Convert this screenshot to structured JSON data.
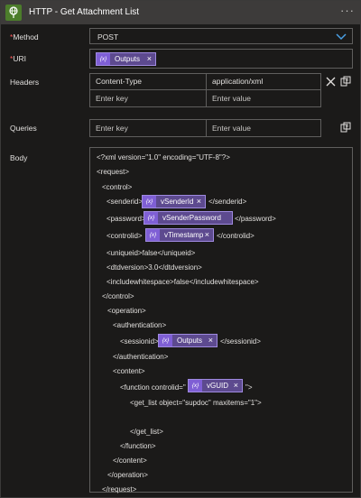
{
  "header": {
    "title": "HTTP - Get Attachment List",
    "more_icon": "ellipsis-icon",
    "app_icon": "globe-icon"
  },
  "fields": {
    "method": {
      "label": "Method",
      "required_mark": "*",
      "value": "POST"
    },
    "uri": {
      "label": "URI",
      "required_mark": "*",
      "token": "Outputs"
    },
    "headers": {
      "label": "Headers",
      "rows": [
        {
          "key": "Content-Type",
          "value": "application/xml"
        }
      ],
      "key_placeholder": "Enter key",
      "value_placeholder": "Enter value"
    },
    "queries": {
      "label": "Queries",
      "key_placeholder": "Enter key",
      "value_placeholder": "Enter value"
    },
    "body": {
      "label": "Body"
    }
  },
  "body_lines": {
    "l1": "<?xml version=\"1.0\" encoding=\"UTF-8\"?>",
    "l2": "<request>",
    "l3": "<control>",
    "l4a": "<senderid>",
    "l4b": "</senderid>",
    "l5a": "<password>",
    "l5b": "</password>",
    "l6a": "<controlid>",
    "l6b": "</controlid>",
    "l7": "<uniqueid>false</uniqueid>",
    "l8": "<dtdversion>3.0</dtdversion>",
    "l9": "<includewhitespace>false</includewhitespace>",
    "l10": "</control>",
    "l11": "<operation>",
    "l12": "<authentication>",
    "l13a": "<sessionid>",
    "l13b": "</sessionid>",
    "l14": "</authentication>",
    "l15": "<content>",
    "l16a": "<function controlid=\"",
    "l16b": "\">",
    "l17": "<get_list object=\"supdoc\" maxitems=\"1\">",
    "l18": "</get_list>",
    "l19": "</function>",
    "l20": "</content>",
    "l21": "</operation>",
    "l22": "</request>"
  },
  "tokens": {
    "icon_text": "{x}",
    "remove_glyph": "×",
    "sender_id": "vSenderId",
    "sender_password": "vSenderPassword",
    "timestamp": "vTimestamp",
    "session_outputs": "Outputs",
    "guid": "vGUID"
  },
  "colors": {
    "accent": "#0078d4",
    "token_bg": "#5d4a8f",
    "token_icon_bg": "#7f5fd5",
    "app_icon_bg": "#4c7d2b"
  }
}
